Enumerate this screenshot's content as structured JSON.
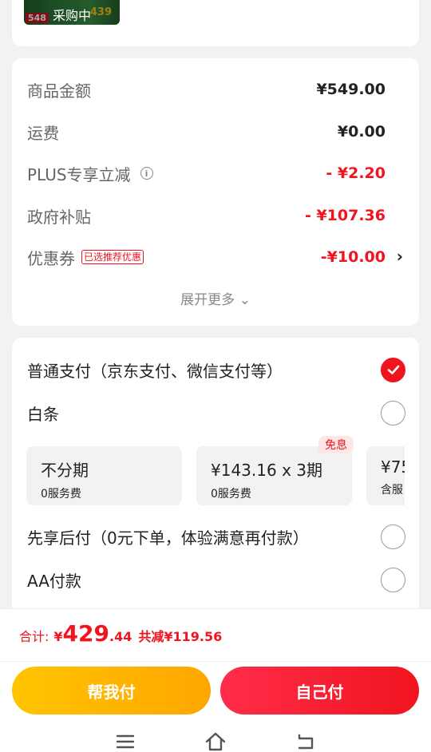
{
  "product": {
    "status": "采购中",
    "tag": "548",
    "num": "439"
  },
  "fees": {
    "items": [
      {
        "label": "商品金额",
        "value": "¥549.00",
        "highlight": false
      },
      {
        "label": "运费",
        "value": "¥0.00",
        "highlight": false
      },
      {
        "label": "PLUS专享立减",
        "value": "- ¥2.20",
        "highlight": true
      },
      {
        "label": "政府补贴",
        "value": "- ¥107.36",
        "highlight": true
      },
      {
        "label": "优惠券",
        "value": "-¥10.00",
        "highlight": true,
        "tag": "已选推荐优惠"
      }
    ],
    "expand_label": "展开更多"
  },
  "payment": {
    "normal_label": "普通支付（京东支付、微信支付等）",
    "baitiao_label": "白条",
    "plans": [
      {
        "title": "不分期",
        "sub": "0服务费"
      },
      {
        "title": "¥143.16 x 3期",
        "sub": "0服务费",
        "badge": "免息"
      },
      {
        "title": "¥75",
        "sub": "含服"
      }
    ],
    "later_label": "先享后付（0元下单，体验满意再付款）",
    "aa_label": "AA付款"
  },
  "footer": {
    "total_label": "合计:",
    "currency": "¥",
    "amount_int": "429",
    "amount_dec": ".44",
    "saved": "共减¥119.56",
    "help_label": "帮我付",
    "self_label": "自己付"
  },
  "colors": {
    "accent": "#f0141e",
    "help_btn": "#ffb300"
  }
}
